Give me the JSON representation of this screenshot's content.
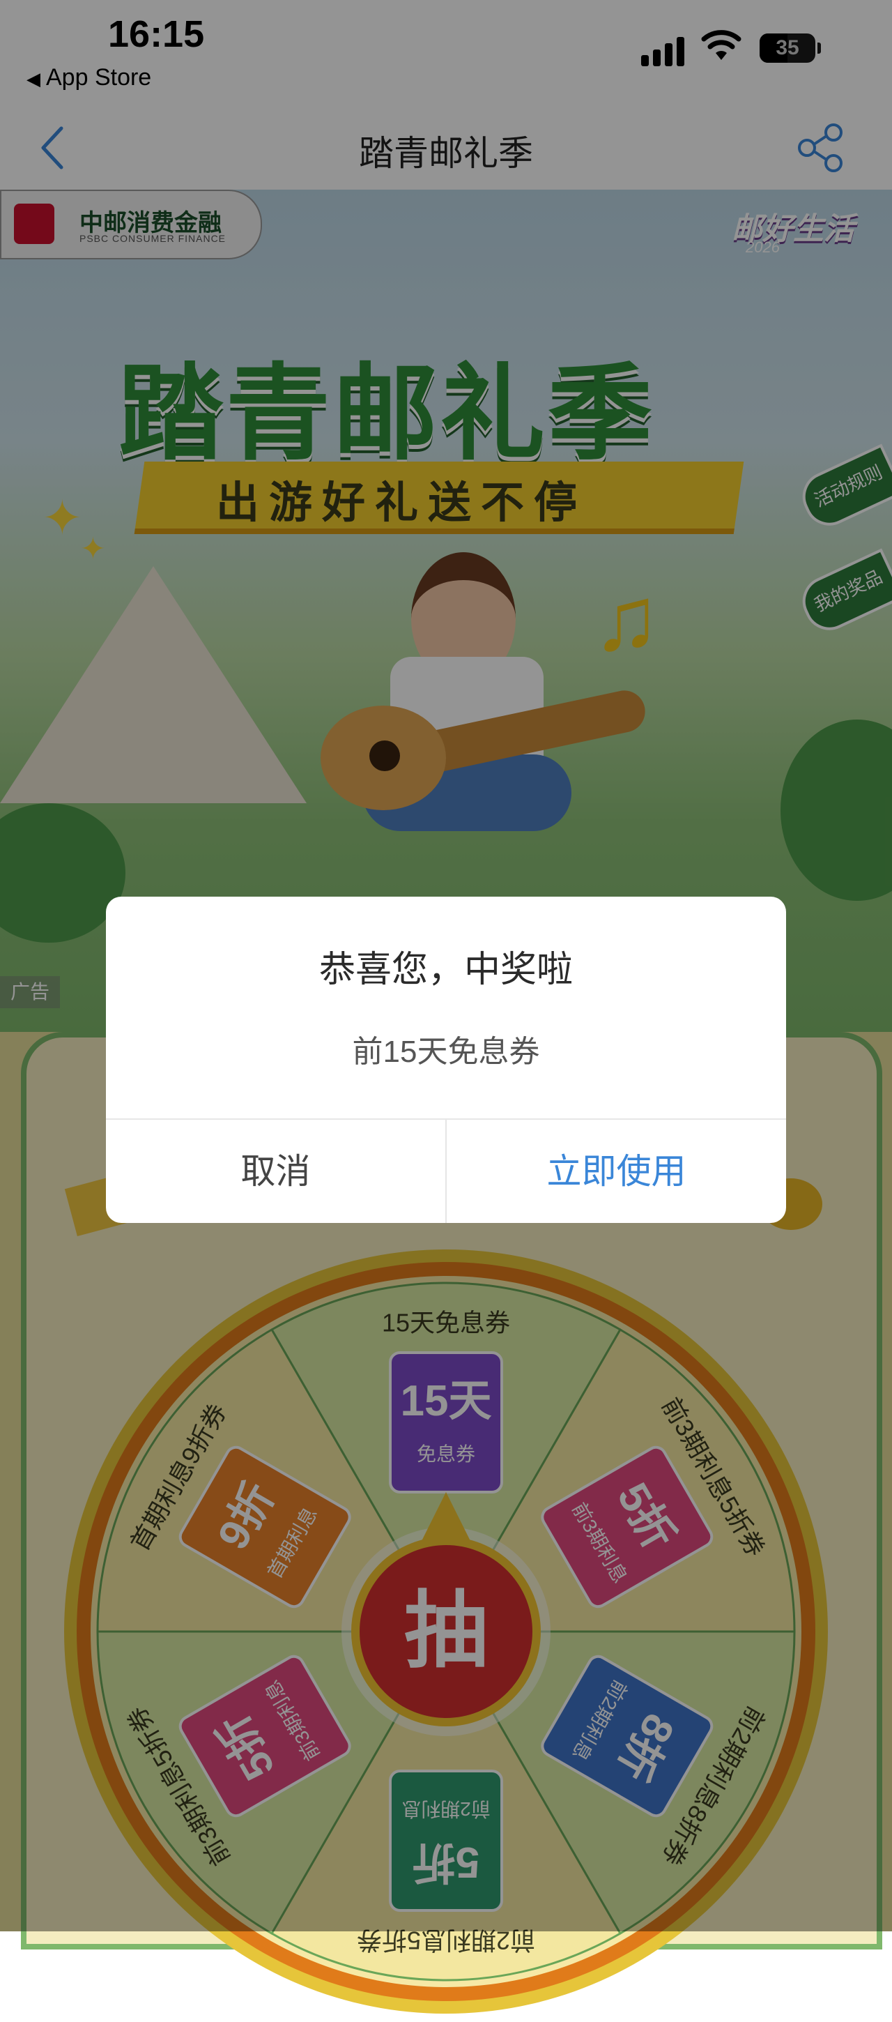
{
  "status_bar": {
    "time": "16:15",
    "back_app": "App Store",
    "battery": "35"
  },
  "nav": {
    "title": "踏青邮礼季"
  },
  "banner": {
    "logo_cn": "中邮消费金融",
    "logo_en": "PSBC CONSUMER FINANCE",
    "corner_logo": "邮好生活",
    "corner_year": "2026",
    "title": "踏青邮礼季",
    "subtitle": "出游好礼送不停",
    "tab_rules": "活动规则",
    "tab_prizes": "我的奖品",
    "ad_label": "广告"
  },
  "wheel": {
    "center_label": "抽",
    "segments": [
      {
        "rim": "15天免息券",
        "ticket_big": "15天",
        "ticket_small": "免息券",
        "color": "#7c4bc9"
      },
      {
        "rim": "前3期利息5折券",
        "ticket_big": "5折",
        "ticket_small": "前3期利息",
        "color": "#e0497e"
      },
      {
        "rim": "前2期利息8折券",
        "ticket_big": "8折",
        "ticket_small": "前2期利息",
        "color": "#3f74c9"
      },
      {
        "rim": "前2期利息5折券",
        "ticket_big": "5折",
        "ticket_small": "前2期利息",
        "color": "#2f9a6e"
      },
      {
        "rim": "前3期利息5折券",
        "ticket_big": "5折",
        "ticket_small": "前3期利息",
        "color": "#e0497e"
      },
      {
        "rim": "首期利息9折券",
        "ticket_big": "9折",
        "ticket_small": "首期利息",
        "color": "#e8822a"
      }
    ]
  },
  "modal": {
    "title": "恭喜您，中奖啦",
    "message": "前15天免息券",
    "cancel": "取消",
    "use_now": "立即使用"
  },
  "colors": {
    "accent_blue": "#3a86d8",
    "wheel_center": "#d32f2f",
    "wheel_rim": "#e07b1a"
  }
}
